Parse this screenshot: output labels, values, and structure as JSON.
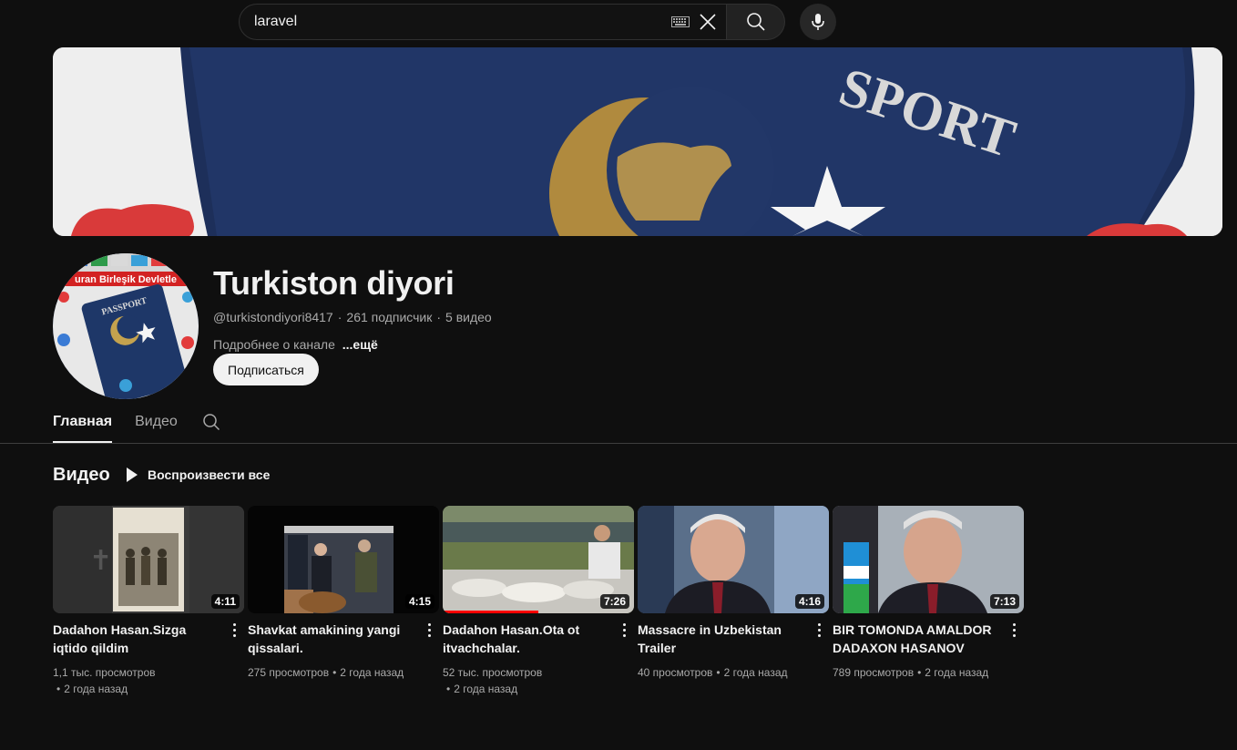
{
  "search": {
    "value": "laravel"
  },
  "channel": {
    "name": "Turkiston diyori",
    "handle": "@turkistondiyori8417",
    "subscribers": "261 подписчик",
    "video_count": "5 видео",
    "about": "Подробнее о канале",
    "more": "...ещё",
    "subscribe_label": "Подписаться",
    "avatar_text": "uran Birleşik Devletle"
  },
  "tabs": [
    {
      "label": "Главная",
      "active": true
    },
    {
      "label": "Видео",
      "active": false
    }
  ],
  "section": {
    "title": "Видео",
    "play_all": "Воспроизвести все"
  },
  "videos": [
    {
      "title": "Dadahon Hasan.Sizga iqtido qildim Shermuhammadbek.",
      "duration": "4:11",
      "views": "1,1 тыс. просмотров",
      "age": "2 года назад"
    },
    {
      "title": "Shavkat amakining yangi qissalari.",
      "duration": "4:15",
      "views": "275 просмотров",
      "age": "2 года назад"
    },
    {
      "title": "Dadahon Hasan.Ota ot itvachchalar.",
      "duration": "7:26",
      "views": "52 тыс. просмотров",
      "age": "2 года назад",
      "progress": 0.5
    },
    {
      "title": "Massacre in Uzbekistan Trailer",
      "duration": "4:16",
      "views": "40 просмотров",
      "age": "2 года назад"
    },
    {
      "title": "BIR TOMONDA AMALDOR DADAXON HASANOV",
      "duration": "7:13",
      "views": "789 просмотров",
      "age": "2 года назад"
    }
  ],
  "colors": {
    "background": "#0f0f0f",
    "accent": "#ff0000",
    "text": "#f1f1f1",
    "muted": "#aaaaaa"
  }
}
